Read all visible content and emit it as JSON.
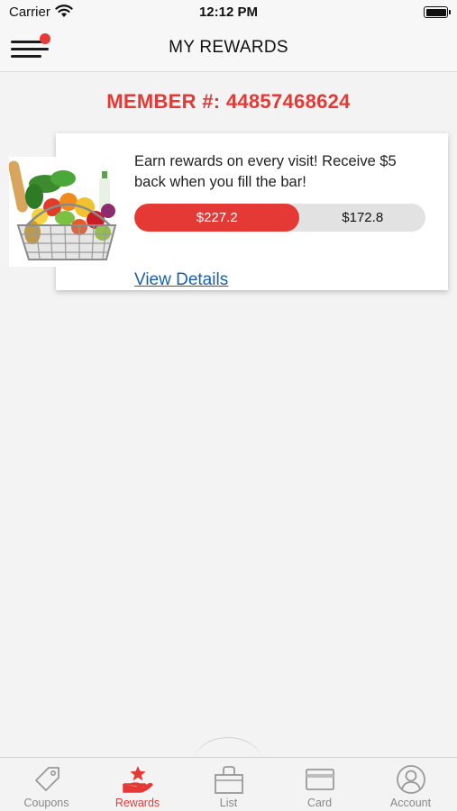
{
  "status_bar": {
    "carrier": "Carrier",
    "time": "12:12 PM"
  },
  "header": {
    "title": "MY REWARDS",
    "menu_has_notification": true
  },
  "member": {
    "label": "MEMBER #: 44857468624"
  },
  "reward_card": {
    "description": "Earn rewards on every visit! Receive $5 back when you fill the bar!",
    "earned_label": "$227.2",
    "remaining_label": "$172.8",
    "progress_fraction": 0.568,
    "link_label": "View Details",
    "image": "grocery-basket"
  },
  "tabs": [
    {
      "label": "Coupons",
      "icon": "tag-icon",
      "active": false
    },
    {
      "label": "Rewards",
      "icon": "rewards-hand-star-icon",
      "active": true
    },
    {
      "label": "List",
      "icon": "shopping-bag-icon",
      "active": false
    },
    {
      "label": "Card",
      "icon": "card-icon",
      "active": false
    },
    {
      "label": "Account",
      "icon": "account-icon",
      "active": false
    }
  ],
  "colors": {
    "accent": "#e53935",
    "link": "#1a5fa8",
    "inactive": "#888888",
    "track": "#e2e2e2"
  }
}
